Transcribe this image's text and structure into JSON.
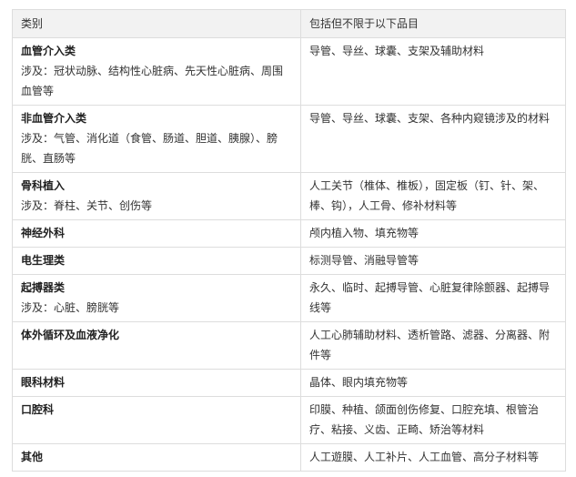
{
  "header": {
    "col1": "类别",
    "col2": "包括但不限于以下品目"
  },
  "rows": [
    {
      "category": "血管介入类",
      "scope": "涉及：冠状动脉、结构性心脏病、先天性心脏病、周围血管等",
      "items": "导管、导丝、球囊、支架及辅助材料"
    },
    {
      "category": "非血管介入类",
      "scope": "涉及：气管、消化道（食管、肠道、胆道、胰腺）、膀胱、直肠等",
      "items": "导管、导丝、球囊、支架、各种内窥镜涉及的材料"
    },
    {
      "category": "骨科植入",
      "scope": "涉及：脊柱、关节、创伤等",
      "items": "人工关节（椎体、椎板），固定板（钉、针、架、棒、钩），人工骨、修补材料等"
    },
    {
      "category": "神经外科",
      "scope": "",
      "items": "颅内植入物、填充物等"
    },
    {
      "category": "电生理类",
      "scope": "",
      "items": "标测导管、消融导管等"
    },
    {
      "category": "起搏器类",
      "scope": "涉及：心脏、膀胱等",
      "items": "永久、临时、起搏导管、心脏复律除颤器、起搏导线等"
    },
    {
      "category": "体外循环及血液净化",
      "scope": "",
      "items": "人工心肺辅助材料、透析管路、滤器、分离器、附件等"
    },
    {
      "category": "眼科材料",
      "scope": "",
      "items": "晶体、眼内填充物等"
    },
    {
      "category": "口腔科",
      "scope": "",
      "items": "印膜、种植、颌面创伤修复、口腔充填、根管治疗、粘接、义齿、正畸、矫治等材料"
    },
    {
      "category": "其他",
      "scope": "",
      "items": "人工遊膜、人工补片、人工血管、高分子材料等"
    }
  ]
}
